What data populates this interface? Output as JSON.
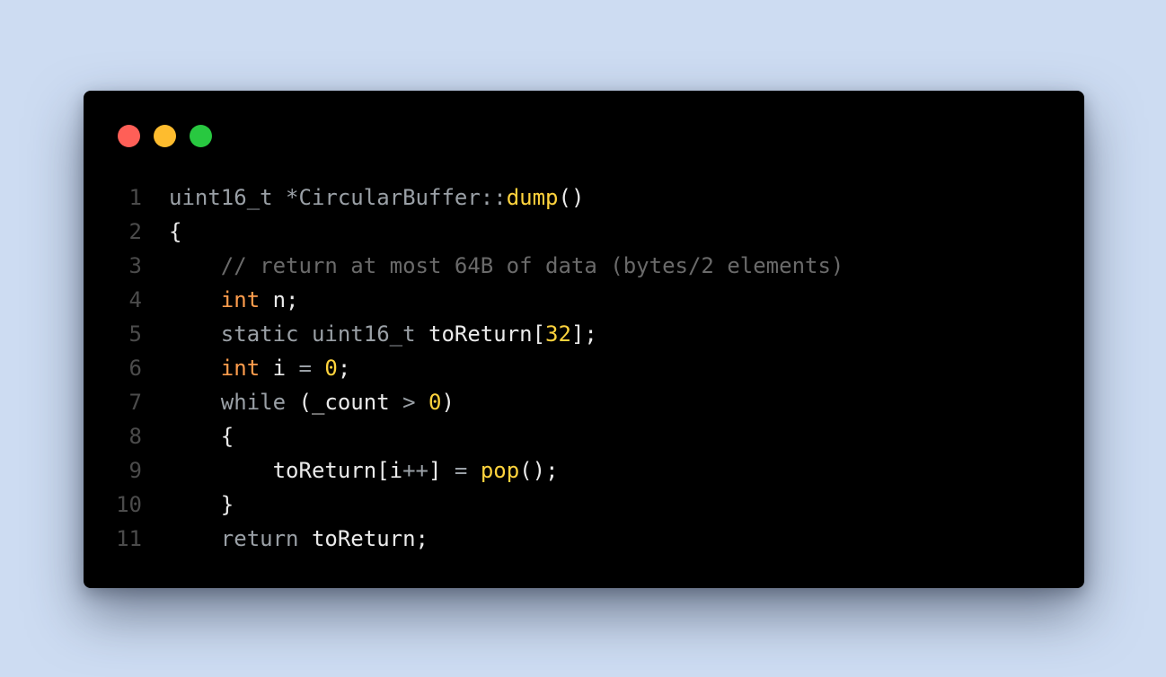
{
  "colors": {
    "background": "#cddcf2",
    "window": "#000000",
    "close": "#ff5f57",
    "minimize": "#febc2e",
    "maximize": "#28c840",
    "line_number": "#4b4b4b",
    "plain": "#eaeaea",
    "type": "#9aa0a6",
    "comment": "#6a6a6a",
    "keyword_int": "#ff9d4d",
    "function": "#ffd33d",
    "number": "#ffd33d",
    "operator": "#9aa0a6"
  },
  "window_controls": [
    {
      "name": "close-button",
      "color": "#ff5f57"
    },
    {
      "name": "minimize-button",
      "color": "#febc2e"
    },
    {
      "name": "maximize-button",
      "color": "#28c840"
    }
  ],
  "code": {
    "lines": [
      {
        "num": "1",
        "tokens": [
          {
            "text": "uint16_t",
            "c": "type"
          },
          {
            "text": " ",
            "c": "plain"
          },
          {
            "text": "*CircularBuffer",
            "c": "type"
          },
          {
            "text": "::",
            "c": "operator"
          },
          {
            "text": "dump",
            "c": "function"
          },
          {
            "text": "()",
            "c": "plain"
          }
        ]
      },
      {
        "num": "2",
        "tokens": [
          {
            "text": "{",
            "c": "plain"
          }
        ]
      },
      {
        "num": "3",
        "tokens": [
          {
            "text": "    // return at most 64B of data (bytes/2 elements)",
            "c": "comment"
          }
        ]
      },
      {
        "num": "4",
        "tokens": [
          {
            "text": "    ",
            "c": "plain"
          },
          {
            "text": "int",
            "c": "keyword_int"
          },
          {
            "text": " n;",
            "c": "plain"
          }
        ]
      },
      {
        "num": "5",
        "tokens": [
          {
            "text": "    ",
            "c": "plain"
          },
          {
            "text": "static uint16_t",
            "c": "type"
          },
          {
            "text": " toReturn[",
            "c": "plain"
          },
          {
            "text": "32",
            "c": "number"
          },
          {
            "text": "];",
            "c": "plain"
          }
        ]
      },
      {
        "num": "6",
        "tokens": [
          {
            "text": "    ",
            "c": "plain"
          },
          {
            "text": "int",
            "c": "keyword_int"
          },
          {
            "text": " i ",
            "c": "plain"
          },
          {
            "text": "=",
            "c": "operator"
          },
          {
            "text": " ",
            "c": "plain"
          },
          {
            "text": "0",
            "c": "number"
          },
          {
            "text": ";",
            "c": "plain"
          }
        ]
      },
      {
        "num": "7",
        "tokens": [
          {
            "text": "    ",
            "c": "plain"
          },
          {
            "text": "while",
            "c": "type"
          },
          {
            "text": " (_count ",
            "c": "plain"
          },
          {
            "text": ">",
            "c": "operator"
          },
          {
            "text": " ",
            "c": "plain"
          },
          {
            "text": "0",
            "c": "number"
          },
          {
            "text": ")",
            "c": "plain"
          }
        ]
      },
      {
        "num": "8",
        "tokens": [
          {
            "text": "    {",
            "c": "plain"
          }
        ]
      },
      {
        "num": "9",
        "tokens": [
          {
            "text": "        toReturn[i",
            "c": "plain"
          },
          {
            "text": "++",
            "c": "operator"
          },
          {
            "text": "] ",
            "c": "plain"
          },
          {
            "text": "=",
            "c": "operator"
          },
          {
            "text": " ",
            "c": "plain"
          },
          {
            "text": "pop",
            "c": "function"
          },
          {
            "text": "();",
            "c": "plain"
          }
        ]
      },
      {
        "num": "10",
        "tokens": [
          {
            "text": "    }",
            "c": "plain"
          }
        ]
      },
      {
        "num": "11",
        "tokens": [
          {
            "text": "    ",
            "c": "plain"
          },
          {
            "text": "return",
            "c": "type"
          },
          {
            "text": " toReturn;",
            "c": "plain"
          }
        ]
      }
    ]
  }
}
